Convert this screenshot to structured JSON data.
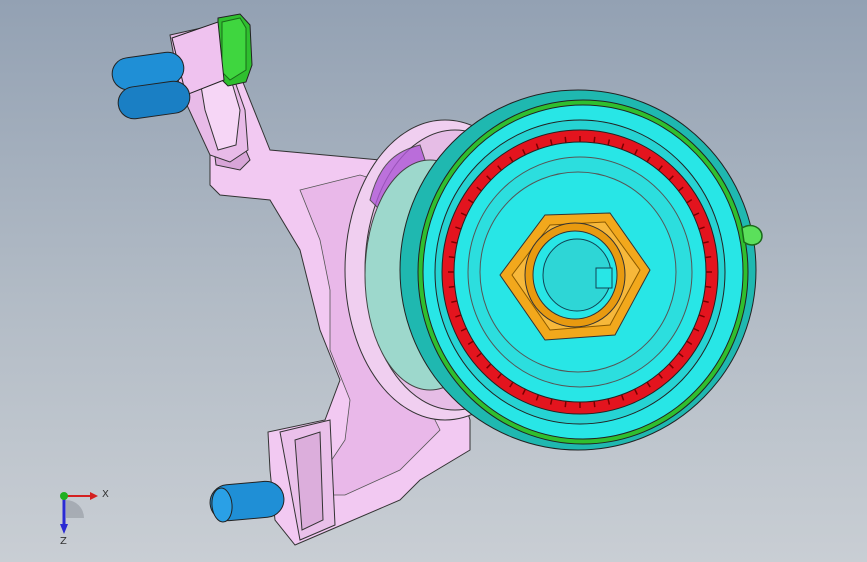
{
  "viewport": {
    "background_top": "#93a1b3",
    "background_bottom": "#c9ced4"
  },
  "model": {
    "bracket_color": "#f2c9f2",
    "bolt_color": "#1f8fd6",
    "nut_green": "#2fbf2f",
    "hub_cyan": "#28e6e6",
    "ring_red": "#e3141e",
    "nut_orange": "#f2a81c",
    "seal_purple": "#b05ad8"
  },
  "triad": {
    "x_label": "X",
    "z_label": "Z",
    "x_color": "#d42020",
    "z_color": "#2a2ad4",
    "y_color": "#20b020"
  }
}
